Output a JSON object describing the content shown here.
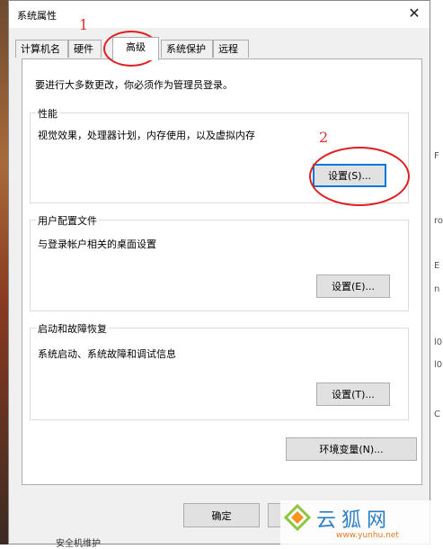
{
  "window": {
    "title": "系统属性",
    "close_glyph": "✕"
  },
  "tabs": [
    {
      "label": "计算机名"
    },
    {
      "label": "硬件"
    },
    {
      "label": "高级",
      "active": true
    },
    {
      "label": "系统保护"
    },
    {
      "label": "远程"
    }
  ],
  "admin_notice": "要进行大多数更改，你必须作为管理员登录。",
  "performance": {
    "title": "性能",
    "description": "视觉效果，处理器计划，内存使用，以及虚拟内存",
    "button": "设置(S)..."
  },
  "user_profiles": {
    "title": "用户配置文件",
    "description": "与登录帐户相关的桌面设置",
    "button": "设置(E)..."
  },
  "startup_recovery": {
    "title": "启动和故障恢复",
    "description": "系统启动、系统故障和调试信息",
    "button": "设置(T)..."
  },
  "env_button": "环境变量(N)...",
  "footer": {
    "ok": "确定"
  },
  "annotations": {
    "step1": "1",
    "step2": "2",
    "color": "#e02020"
  },
  "watermark": {
    "brand": "云狐网",
    "url": "www.yunhu.net"
  },
  "background_bottom_text": "安全机维护",
  "background_right_fragments": [
    "F",
    "ro",
    "E",
    "n",
    "l0",
    "l0",
    "C"
  ]
}
